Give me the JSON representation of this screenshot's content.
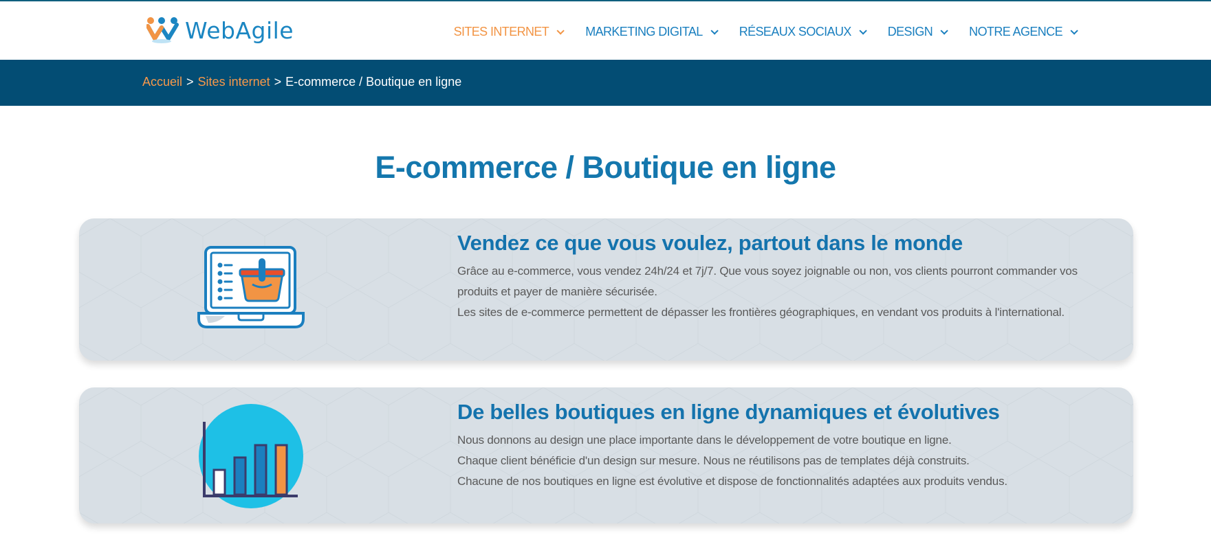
{
  "brand": {
    "name": "WebAgile",
    "colors": {
      "primary": "#1477ad",
      "accent": "#f29444",
      "band": "#034d74",
      "card": "#d8dfe5"
    }
  },
  "nav": {
    "items": [
      {
        "label": "SITES INTERNET",
        "active": true
      },
      {
        "label": "MARKETING DIGITAL",
        "active": false
      },
      {
        "label": "RÉSEAUX SOCIAUX",
        "active": false
      },
      {
        "label": "DESIGN",
        "active": false
      },
      {
        "label": "NOTRE AGENCE",
        "active": false
      }
    ]
  },
  "breadcrumb": {
    "home": "Accueil",
    "separator": ">",
    "section": "Sites internet",
    "current": "E-commerce / Boutique en ligne"
  },
  "page_title": "E-commerce / Boutique en ligne",
  "cards": [
    {
      "icon": "laptop-shopping-basket-icon",
      "heading": "Vendez ce que vous voulez, partout dans le monde",
      "paragraphs": [
        "Grâce au e-commerce, vous vendez 24h/24 et 7j/7. Que vous soyez joignable ou non, vos clients pourront commander vos produits et payer de manière sécurisée.",
        "Les sites de e-commerce permettent de dépasser les frontières géographiques, en vendant vos produits à l'international."
      ]
    },
    {
      "icon": "bar-chart-growth-icon",
      "heading": "De belles boutiques en ligne dynamiques et évolutives",
      "paragraphs": [
        "Nous donnons au design une place importante dans le développement de votre boutique en ligne.",
        "Chaque client bénéficie d'un design sur mesure. Nous ne réutilisons pas de templates déjà construits.",
        "Chacune de nos boutiques en ligne est évolutive et dispose de fonctionnalités adaptées aux produits vendus."
      ]
    }
  ]
}
